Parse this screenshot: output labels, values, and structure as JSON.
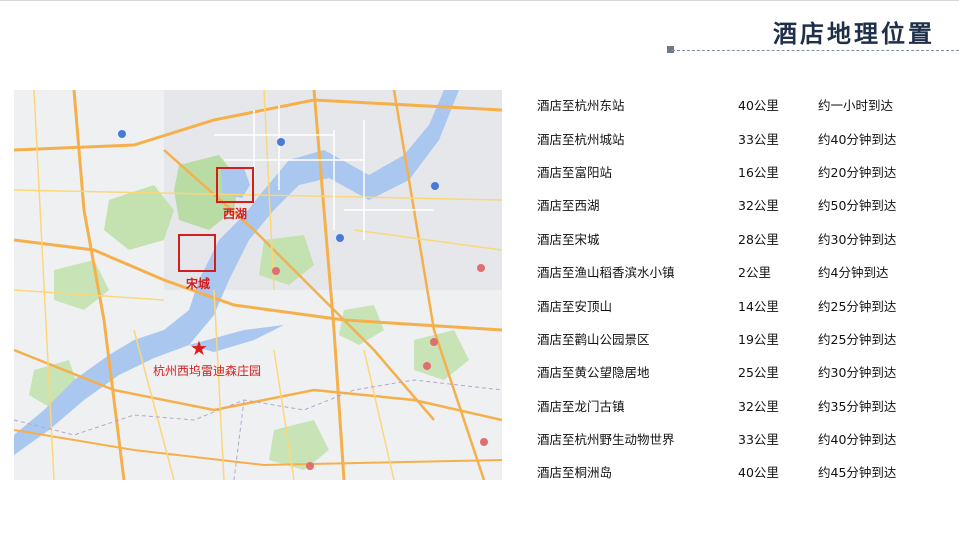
{
  "title": "酒店地理位置",
  "map": {
    "labels": {
      "west_lake": "西湖",
      "songcheng": "宋城",
      "resort": "杭州西坞雷迪森庄园"
    },
    "marker_icon": "red-star-icon"
  },
  "distances": [
    {
      "place": "酒店至杭州东站",
      "distance": "40公里",
      "time": "约一小时到达"
    },
    {
      "place": "酒店至杭州城站",
      "distance": "33公里",
      "time": "约40分钟到达"
    },
    {
      "place": "酒店至富阳站",
      "distance": "16公里",
      "time": "约20分钟到达"
    },
    {
      "place": "酒店至西湖",
      "distance": "32公里",
      "time": "约50分钟到达"
    },
    {
      "place": "酒店至宋城",
      "distance": "28公里",
      "time": "约30分钟到达"
    },
    {
      "place": "酒店至渔山稻香滨水小镇",
      "distance": "2公里",
      "time": "约4分钟到达"
    },
    {
      "place": "酒店至安顶山",
      "distance": "14公里",
      "time": "约25分钟到达"
    },
    {
      "place": "酒店至鹳山公园景区",
      "distance": "19公里",
      "time": "约25分钟到达"
    },
    {
      "place": "酒店至黄公望隐居地",
      "distance": "25公里",
      "time": "约30分钟到达"
    },
    {
      "place": "酒店至龙门古镇",
      "distance": "32公里",
      "time": "约35分钟到达"
    },
    {
      "place": "酒店至杭州野生动物世界",
      "distance": "33公里",
      "time": "约40分钟到达"
    },
    {
      "place": "酒店至桐洲岛",
      "distance": "40公里",
      "time": "约45分钟到达"
    }
  ]
}
